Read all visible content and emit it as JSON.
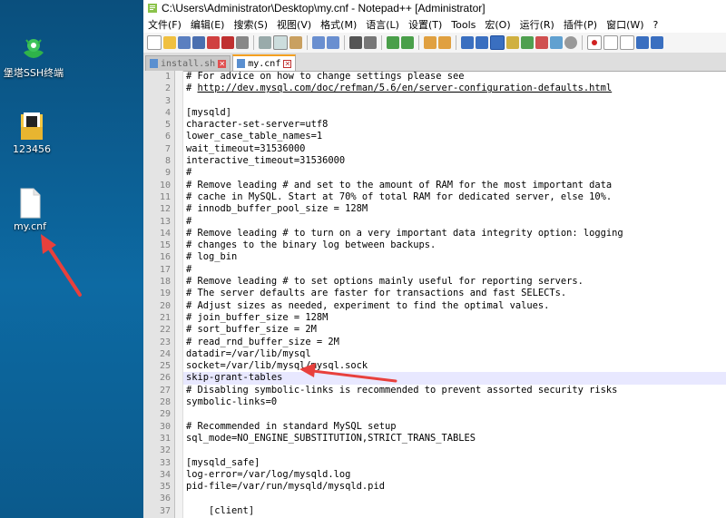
{
  "desktop": {
    "icons": [
      {
        "label": "堡塔SSH终端"
      },
      {
        "label": "123456"
      },
      {
        "label": "my.cnf"
      }
    ]
  },
  "window": {
    "title": "C:\\Users\\Administrator\\Desktop\\my.cnf - Notepad++ [Administrator]",
    "menu": [
      "文件(F)",
      "编辑(E)",
      "搜索(S)",
      "视图(V)",
      "格式(M)",
      "语言(L)",
      "设置(T)",
      "Tools",
      "宏(O)",
      "运行(R)",
      "插件(P)",
      "窗口(W)",
      "?"
    ],
    "tabs": [
      {
        "label": "install.sh",
        "active": false
      },
      {
        "label": "my.cnf",
        "active": true
      }
    ]
  },
  "editor": {
    "lines": [
      {
        "n": "1",
        "text": "# For advice on how to change settings please see"
      },
      {
        "n": "2",
        "text": "# http://dev.mysql.com/doc/refman/5.6/en/server-configuration-defaults.html"
      },
      {
        "n": "3",
        "text": ""
      },
      {
        "n": "4",
        "text": "[mysqld]"
      },
      {
        "n": "5",
        "text": "character-set-server=utf8"
      },
      {
        "n": "6",
        "text": "lower_case_table_names=1"
      },
      {
        "n": "7",
        "text": "wait_timeout=31536000"
      },
      {
        "n": "8",
        "text": "interactive_timeout=31536000"
      },
      {
        "n": "9",
        "text": "#"
      },
      {
        "n": "10",
        "text": "# Remove leading # and set to the amount of RAM for the most important data"
      },
      {
        "n": "11",
        "text": "# cache in MySQL. Start at 70% of total RAM for dedicated server, else 10%."
      },
      {
        "n": "12",
        "text": "# innodb_buffer_pool_size = 128M"
      },
      {
        "n": "13",
        "text": "#"
      },
      {
        "n": "14",
        "text": "# Remove leading # to turn on a very important data integrity option: logging"
      },
      {
        "n": "15",
        "text": "# changes to the binary log between backups."
      },
      {
        "n": "16",
        "text": "# log_bin"
      },
      {
        "n": "17",
        "text": "#"
      },
      {
        "n": "18",
        "text": "# Remove leading # to set options mainly useful for reporting servers."
      },
      {
        "n": "19",
        "text": "# The server defaults are faster for transactions and fast SELECTs."
      },
      {
        "n": "20",
        "text": "# Adjust sizes as needed, experiment to find the optimal values."
      },
      {
        "n": "21",
        "text": "# join_buffer_size = 128M"
      },
      {
        "n": "22",
        "text": "# sort_buffer_size = 2M"
      },
      {
        "n": "23",
        "text": "# read_rnd_buffer_size = 2M"
      },
      {
        "n": "24",
        "text": "datadir=/var/lib/mysql"
      },
      {
        "n": "25",
        "text": "socket=/var/lib/mysql/mysql.sock"
      },
      {
        "n": "26",
        "text": "skip-grant-tables"
      },
      {
        "n": "27",
        "text": "# Disabling symbolic-links is recommended to prevent assorted security risks"
      },
      {
        "n": "28",
        "text": "symbolic-links=0"
      },
      {
        "n": "29",
        "text": ""
      },
      {
        "n": "30",
        "text": "# Recommended in standard MySQL setup"
      },
      {
        "n": "31",
        "text": "sql_mode=NO_ENGINE_SUBSTITUTION,STRICT_TRANS_TABLES"
      },
      {
        "n": "32",
        "text": ""
      },
      {
        "n": "33",
        "text": "[mysqld_safe]"
      },
      {
        "n": "34",
        "text": "log-error=/var/log/mysqld.log"
      },
      {
        "n": "35",
        "text": "pid-file=/var/run/mysqld/mysqld.pid"
      },
      {
        "n": "36",
        "text": ""
      },
      {
        "n": "37",
        "text": "    [client]"
      }
    ],
    "highlighted_line": "26"
  },
  "colors": {
    "annotation_arrow": "#e8403c",
    "active_tab_accent": "#f4a020",
    "current_line": "#e8e8ff"
  },
  "icons": [
    "notepadpp-icon",
    "new-file-icon",
    "open-file-icon",
    "save-icon",
    "save-all-icon",
    "close-icon",
    "print-icon",
    "cut-icon",
    "copy-icon",
    "paste-icon",
    "undo-icon",
    "redo-icon",
    "find-icon",
    "replace-icon",
    "zoom-in-icon",
    "zoom-out-icon",
    "record-macro-icon",
    "stop-macro-icon",
    "play-macro-icon"
  ]
}
